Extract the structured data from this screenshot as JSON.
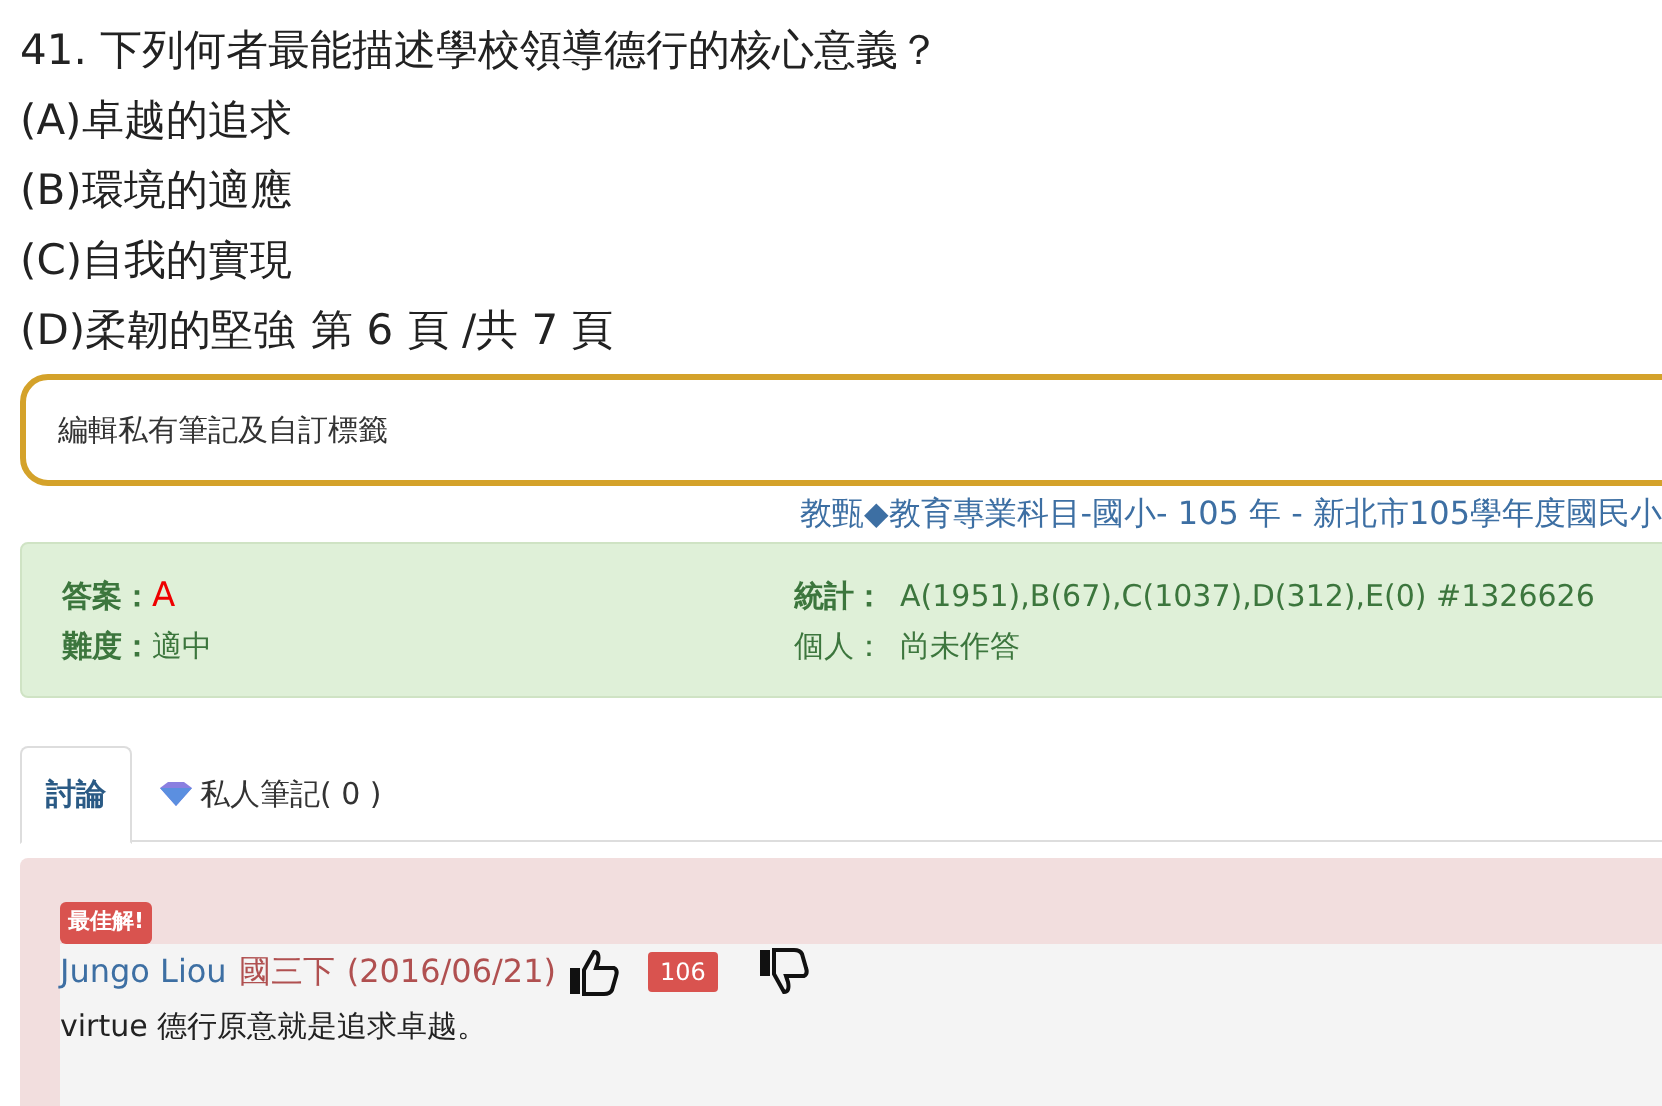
{
  "question": {
    "stem": "41. 下列何者最能描述學校領導德行的核心意義？",
    "options": [
      {
        "label": "(A)卓越的追求"
      },
      {
        "label": "(B)環境的適應"
      },
      {
        "label": "(C)自我的實現"
      },
      {
        "label": "(D)柔韌的堅強"
      }
    ],
    "page_info": "第 6 頁 /共 7 頁"
  },
  "note_field": {
    "placeholder": "編輯私有筆記及自訂標籤"
  },
  "source_link": "教甄◆教育專業科目-國小- 105 年 - 新北市105學年度國民小",
  "info_box": {
    "answer_label": "答案：",
    "answer": "A",
    "difficulty_label": "難度：",
    "difficulty": "適中",
    "stats_label": "統計：",
    "stats": "A(1951),B(67),C(1037),D(312),E(0) #1326626",
    "personal_label": "個人：",
    "personal": "尚未作答"
  },
  "tabs": [
    {
      "label": "討論",
      "selected": true,
      "kind": "plain"
    },
    {
      "label": "私人筆記( 0 )",
      "selected": false,
      "kind": "gem"
    }
  ],
  "comment": {
    "badge": "最佳解!",
    "author": "Jungo Liou",
    "grade": "國三下",
    "date": "(2016/06/21)",
    "likes": "106",
    "body": "virtue 德行原意就是追求卓越。"
  }
}
